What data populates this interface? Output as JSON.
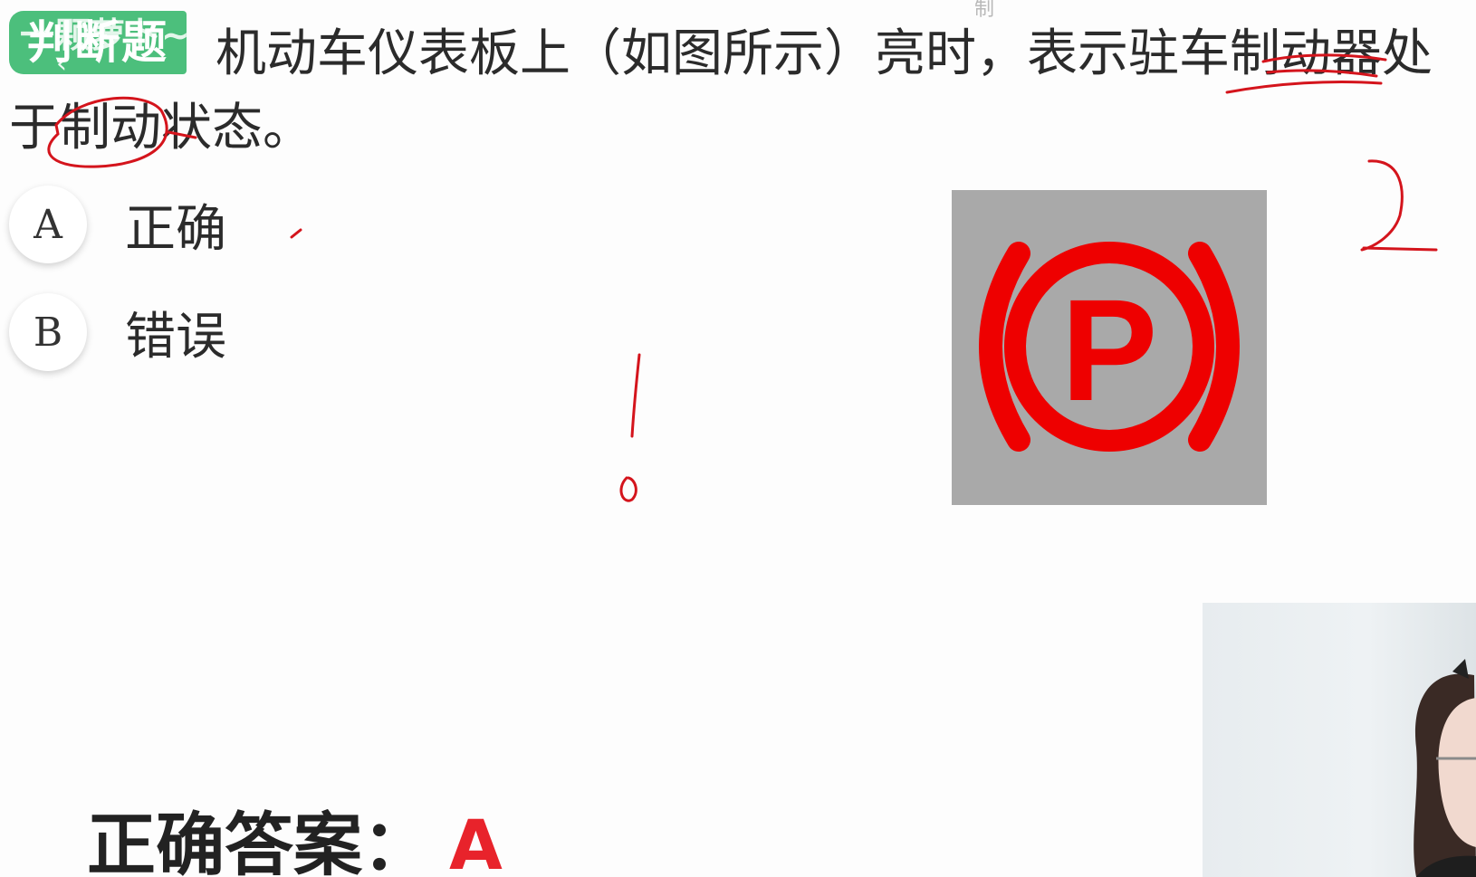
{
  "question": {
    "badge": "判断题",
    "overlay": "一颗萝卜~",
    "line1": "机动车仪表板上（如图所示）亮时，表示驻车制动器处",
    "line2": "于制动状态。",
    "top_fragment": "制"
  },
  "options": [
    {
      "letter": "A",
      "text": "正确"
    },
    {
      "letter": "B",
      "text": "错误"
    }
  ],
  "answer": {
    "label": "正确答案：",
    "value": "A"
  },
  "sign": {
    "glyph": "P",
    "background_color": "#a9a9a9",
    "symbol_color": "#ee0000"
  },
  "colors": {
    "badge": "#4cbf7c",
    "annotation": "#d4141c",
    "answer_letter": "#e8232b"
  },
  "icons": {
    "back": "chevron-left-icon",
    "sign": "parking-brake-icon"
  }
}
